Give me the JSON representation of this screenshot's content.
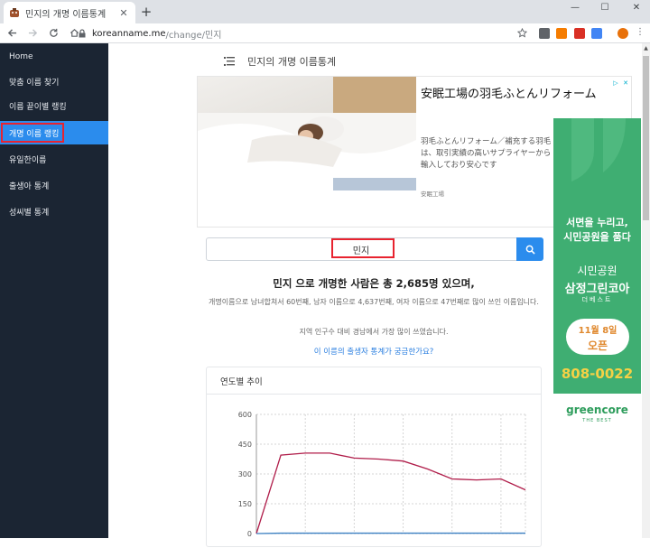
{
  "browser": {
    "tab_title": "민지의 개명 이름통계",
    "new_tab_symbol": "+",
    "tab_close_symbol": "✕",
    "url_host": "koreanname.me",
    "url_path": "/change/민지",
    "window_controls": {
      "minimize": "—",
      "maximize": "☐",
      "close": "✕"
    },
    "extensions": [
      {
        "name": "ext-orange",
        "label": "",
        "color": "#f57c00"
      },
      {
        "name": "ext-red",
        "label": "",
        "color": "#d93025"
      },
      {
        "name": "ext-translate",
        "label": "",
        "color": "#4285f4"
      },
      {
        "name": "ext-cast",
        "label": "",
        "color": "#5f6368"
      }
    ],
    "profile_color": "#e8710a"
  },
  "sidebar": {
    "items": [
      {
        "label": "Home"
      },
      {
        "label": "맞춤 이름 찾기"
      },
      {
        "label": "이름 끝이별 랭킹"
      },
      {
        "label": "개명 이름 랭킹"
      },
      {
        "label": "유일한이름"
      },
      {
        "label": "출생아 통계"
      },
      {
        "label": "성씨별 통계"
      }
    ],
    "active_index": 3
  },
  "header": {
    "title": "민지의 개명 이름통계"
  },
  "ad_top": {
    "title": "安眠工場の羽毛ふとんリフォーム",
    "description": "羽毛ふとんリフォーム／補充する羽毛は、取引実績の高いサプライヤーから輸入しており安心です",
    "brand": "安眠工場"
  },
  "search": {
    "value": "민지",
    "button_icon": "search-icon"
  },
  "result": {
    "headline": "민지 으로 개명한 사람은 총 2,685명 있으며,",
    "detail": "개명이름으로 남녀합쳐서 60번째, 남자 이름으로 4,637번째, 여자 이름으로 47번째로 많이 쓰인 이름입니다.",
    "region": "지역 인구수 대비 경남에서 가장 많이 쓰였습니다.",
    "link": "이 이름의 출생자 통계가 궁금한가요?"
  },
  "chart_card": {
    "title": "연도별 추이"
  },
  "chart_data": {
    "type": "line",
    "title": "연도별 추이",
    "xlabel": "",
    "ylabel": "",
    "ylim": [
      0,
      600
    ],
    "yticks": [
      0,
      150,
      300,
      450,
      600
    ],
    "grid": true,
    "x": [
      0,
      1,
      2,
      3,
      4,
      5,
      6,
      7,
      8,
      9,
      10,
      11
    ],
    "series": [
      {
        "values": [
          0,
          395,
          405,
          405,
          380,
          375,
          365,
          325,
          275,
          270,
          275,
          220
        ],
        "color": "#b01d4a"
      },
      {
        "values": [
          0,
          2,
          2,
          2,
          2,
          2,
          2,
          2,
          2,
          2,
          2,
          2
        ],
        "color": "#3a7fc1"
      }
    ]
  },
  "ad_side": {
    "line1": "서면을 누리고,",
    "line2": "시민공원을 품다",
    "line3": "시민공원",
    "line4": "삼정그린코아",
    "line5": "더베스트",
    "date": "11월 8일",
    "open": "오픈",
    "phone": "808-0022",
    "brand": "greencore",
    "brand_sub": "THE BEST"
  },
  "colors": {
    "sidebar_bg": "#1b2533",
    "accent": "#2b8ced",
    "highlight_red": "#e8232f",
    "line_main": "#b01d4a"
  }
}
